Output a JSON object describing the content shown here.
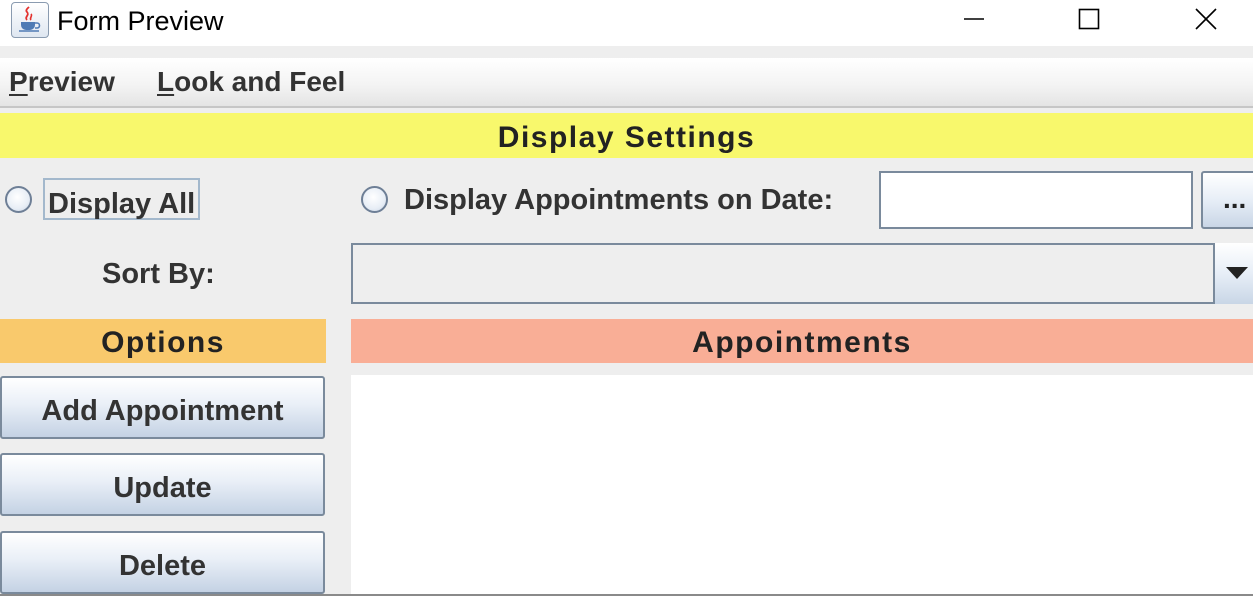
{
  "window": {
    "title": "Form Preview",
    "icon": "java-coffee-cup-icon"
  },
  "menubar": {
    "items": [
      {
        "label": "Preview",
        "mnemonic": "P"
      },
      {
        "label": "Look and Feel",
        "mnemonic": "L"
      }
    ]
  },
  "display_settings": {
    "header": "Display Settings",
    "radio_all_label": "Display All",
    "radio_date_label": "Display Appointments on Date:",
    "radio_all_selected": false,
    "radio_date_selected": false,
    "date_value": "",
    "date_button_label": "..."
  },
  "sort": {
    "label": "Sort By:",
    "selected_value": ""
  },
  "options": {
    "header": "Options",
    "buttons": [
      "Add Appointment",
      "Update",
      "Delete"
    ]
  },
  "appointments": {
    "header": "Appointments",
    "items": []
  },
  "colors": {
    "display_header_bg": "#f8f86c",
    "options_header_bg": "#f9c96c",
    "appointments_header_bg": "#f9ae96"
  }
}
